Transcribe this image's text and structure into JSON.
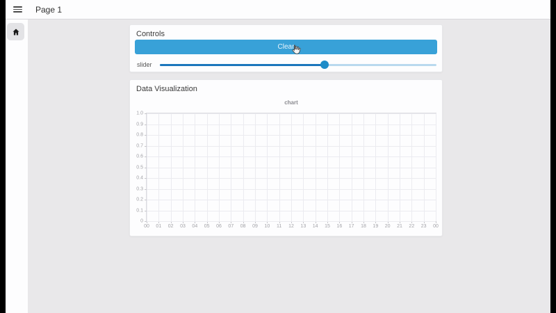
{
  "window": {
    "title": "Page 1"
  },
  "header": {
    "menu_icon": "hamburger"
  },
  "sidebar": {
    "items": [
      {
        "icon": "home-icon",
        "name": "home"
      }
    ]
  },
  "controls_card": {
    "title": "Controls",
    "clear_button": "Clear",
    "slider": {
      "label": "slider",
      "value_percent": 59.5
    }
  },
  "viz_card": {
    "title": "Data Visualization"
  },
  "chart_data": {
    "type": "line",
    "title": "chart",
    "xlabel": "",
    "ylabel": "",
    "x_ticks": [
      "00",
      "01",
      "02",
      "03",
      "04",
      "05",
      "06",
      "07",
      "08",
      "09",
      "10",
      "11",
      "12",
      "13",
      "14",
      "15",
      "16",
      "17",
      "18",
      "19",
      "20",
      "21",
      "22",
      "23",
      "00"
    ],
    "y_ticks": [
      "1.0",
      "0.9",
      "0.8",
      "0.7",
      "0.6",
      "0.5",
      "0.4",
      "0.3",
      "0.2",
      "0.1",
      "0"
    ],
    "ylim": [
      0,
      1
    ],
    "grid": true,
    "series": [],
    "legend": null
  },
  "colors": {
    "accent_blue": "#38a1d8",
    "button_text": "#e8f4fb",
    "slider_fill": "#1b76bc",
    "slider_thumb": "#1e8cc8",
    "slider_track_rest": "#b9d9ee",
    "page_background": "#e9e8ea",
    "edge_bar": "#000000"
  }
}
